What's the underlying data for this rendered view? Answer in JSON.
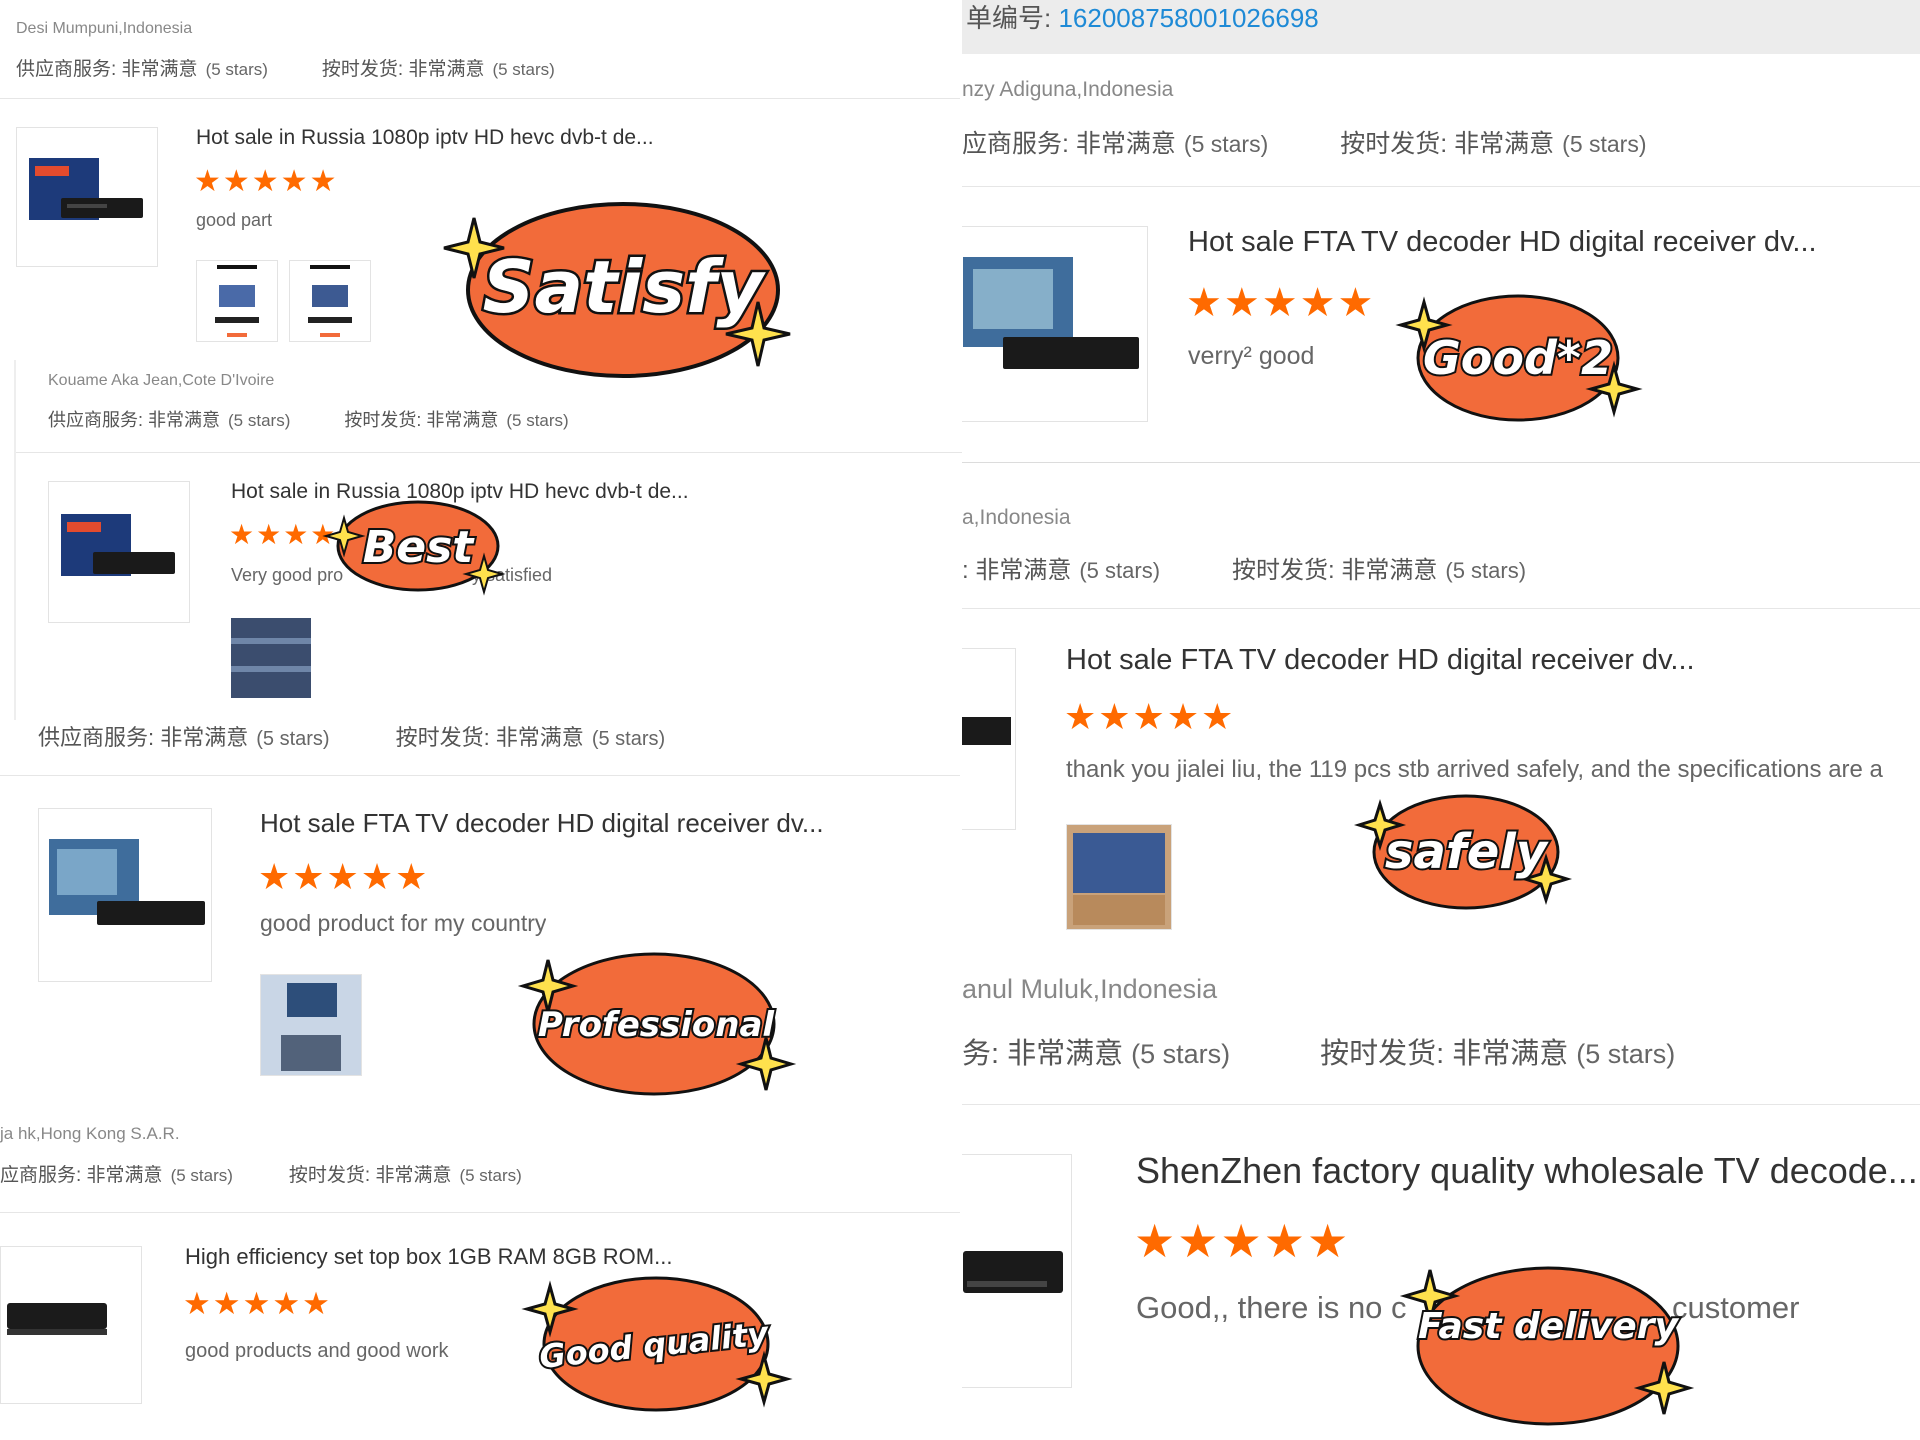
{
  "colors": {
    "star": "#ff6a00",
    "badge_fill": "#f26b3a",
    "order_link": "#1e8ad6"
  },
  "icons": {
    "star": "star-icon",
    "sparkle": "sparkle-icon"
  },
  "left_panel_1": {
    "reviewer": "Desi Mumpuni,Indonesia",
    "service": "供应商服务: 非常满意",
    "service_stars": "(5 stars)",
    "shipping": "按时发货: 非常满意",
    "shipping_stars": "(5 stars)",
    "product_title": "Hot sale in Russia 1080p iptv HD hevc dvb-t de...",
    "stars": "★★★★★",
    "comment": "good part",
    "badge": "Satisfy"
  },
  "left_panel_2": {
    "reviewer": "Kouame Aka Jean,Cote D'Ivoire",
    "service": "供应商服务: 非常满意",
    "service_stars": "(5 stars)",
    "shipping": "按时发货: 非常满意",
    "shipping_stars": "(5 stars)",
    "product_title": "Hot sale in Russia 1080p iptv HD hevc dvb-t de...",
    "stars": "★★★★★",
    "comment_a": "Very good pro",
    "comment_b": "ery satisfied",
    "badge": "Best"
  },
  "left_panel_3": {
    "service": "供应商服务: 非常满意",
    "service_stars": "(5 stars)",
    "shipping": "按时发货: 非常满意",
    "shipping_stars": "(5 stars)",
    "product_title": "Hot sale FTA TV decoder HD digital receiver dv...",
    "stars": "★★★★★",
    "comment": "good product for my country",
    "badge": "Professional"
  },
  "left_panel_4": {
    "reviewer": "ja hk,Hong Kong S.A.R.",
    "service": "应商服务: 非常满意",
    "service_stars": "(5 stars)",
    "shipping": "按时发货: 非常满意",
    "shipping_stars": "(5 stars)",
    "product_title": "High efficiency set top box 1GB RAM 8GB ROM...",
    "stars": "★★★★★",
    "comment": "good products and good work",
    "badge": "Good quality"
  },
  "right_panel_1": {
    "order_label": "单编号: ",
    "order_number": "162008758001026698",
    "reviewer": "nzy Adiguna,Indonesia",
    "service": "应商服务: 非常满意",
    "service_stars": "(5 stars)",
    "shipping": "按时发货: 非常满意",
    "shipping_stars": "(5 stars)",
    "product_title": "Hot sale FTA TV decoder HD digital receiver dv...",
    "stars": "★★★★★",
    "comment": "verry² good",
    "badge": "Good*2"
  },
  "right_panel_2": {
    "reviewer": "a,Indonesia",
    "service": ": 非常满意",
    "service_stars": "(5 stars)",
    "shipping": "按时发货: 非常满意",
    "shipping_stars": "(5 stars)",
    "product_title": "Hot sale FTA TV decoder HD digital receiver dv...",
    "stars": "★★★★★",
    "comment": "thank you jialei liu, the 119 pcs stb arrived safely, and the specifications are a",
    "badge": "safely"
  },
  "right_panel_3": {
    "reviewer": "anul Muluk,Indonesia",
    "service": "务: 非常满意",
    "service_stars": "(5 stars)",
    "shipping": "按时发货: 非常满意",
    "shipping_stars": "(5 stars)",
    "product_title": "ShenZhen factory quality wholesale TV decode...",
    "stars": "★★★★★",
    "comment_a": "Good,, there is no c",
    "comment_b": "customer",
    "badge": "Fast delivery"
  }
}
